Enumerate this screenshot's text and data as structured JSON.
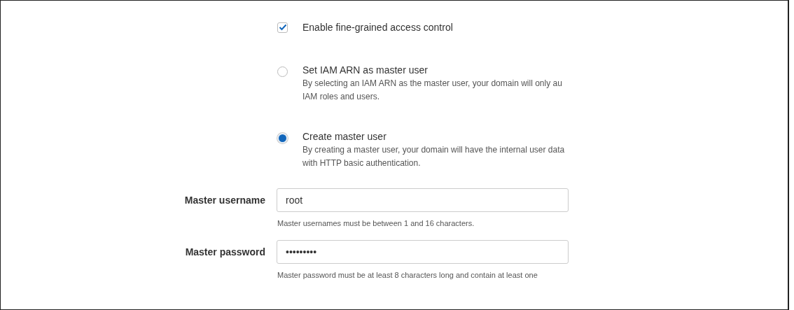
{
  "fine_grained_access": {
    "label": "Enable fine-grained access control",
    "checked": true
  },
  "master_user_options": [
    {
      "label": "Set IAM ARN as master user",
      "description": [
        "By selecting an IAM ARN as the master user, your domain will only au",
        "IAM roles and users."
      ],
      "selected": false
    },
    {
      "label": "Create master user",
      "description": [
        "By creating a master user, your domain will have the internal user data",
        "with HTTP basic authentication."
      ],
      "selected": true
    }
  ],
  "fields": [
    {
      "label": "Master username",
      "value": "root",
      "hint": "Master usernames must be between 1 and 16 characters."
    },
    {
      "label": "Master password",
      "value": "•••••••••",
      "hint": "Master password must be at least 8 characters long and contain at least one"
    }
  ]
}
